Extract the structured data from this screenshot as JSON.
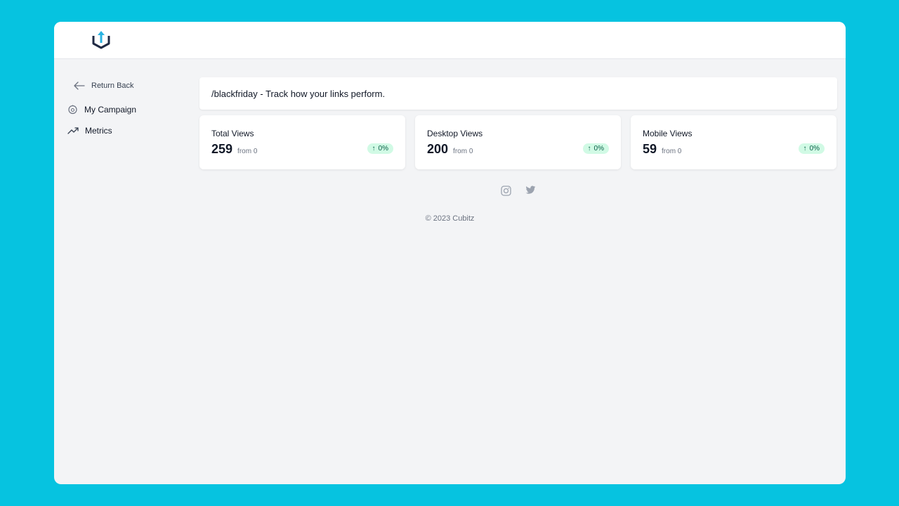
{
  "sidebar": {
    "back_label": "Return Back",
    "items": [
      {
        "label": "My Campaign",
        "icon": "campaign-icon"
      },
      {
        "label": "Metrics",
        "icon": "trending-up-icon"
      }
    ]
  },
  "header": {
    "title": "/blackfriday - Track how your links perform."
  },
  "stats": [
    {
      "title": "Total Views",
      "value": "259",
      "from": "from 0",
      "change": "0%"
    },
    {
      "title": "Desktop Views",
      "value": "200",
      "from": "from 0",
      "change": "0%"
    },
    {
      "title": "Mobile Views",
      "value": "59",
      "from": "from 0",
      "change": "0%"
    }
  ],
  "footer": {
    "copyright": "© 2023 Cubitz",
    "socials": [
      "instagram-icon",
      "twitter-icon"
    ]
  },
  "colors": {
    "background": "#06c3e0",
    "accent": "#2ab3e2",
    "logo_dark": "#1f2a44",
    "badge_bg": "#d1fae5",
    "badge_text": "#065f46"
  }
}
